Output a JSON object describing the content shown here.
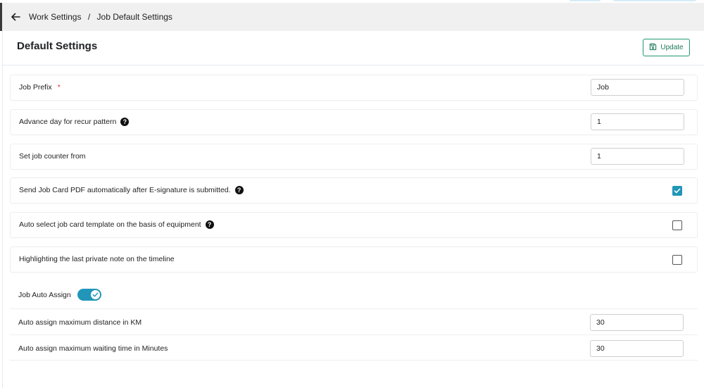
{
  "breadcrumb": {
    "parent": "Work Settings",
    "separator": "/",
    "current": "Job Default Settings"
  },
  "page": {
    "title": "Default Settings",
    "update_label": "Update"
  },
  "settings": {
    "job_prefix": {
      "label": "Job Prefix",
      "required_mark": "*",
      "value": "Job"
    },
    "advance_day": {
      "label": "Advance day for recur pattern",
      "help": "?",
      "value": "1"
    },
    "job_counter": {
      "label": "Set job counter from",
      "value": "1"
    },
    "send_pdf": {
      "label": "Send Job Card PDF automatically after E-signature is submitted.",
      "help": "?",
      "checked": true
    },
    "auto_template": {
      "label": "Auto select job card template on the basis of equipment",
      "help": "?",
      "checked": false
    },
    "highlight_note": {
      "label": "Highlighting the last private note on the timeline",
      "checked": false
    }
  },
  "auto_assign": {
    "label": "Job Auto Assign",
    "enabled": true,
    "max_distance": {
      "label": "Auto assign maximum distance in KM",
      "value": "30"
    },
    "max_wait": {
      "label": "Auto assign maximum waiting time in Minutes",
      "value": "30"
    }
  },
  "colors": {
    "accent": "#2196b8",
    "update_border": "#1e9a71",
    "required": "#e0303a"
  },
  "icons": {
    "back": "arrow-left-icon",
    "update": "save-icon",
    "help": "question-circle-icon",
    "check": "check-icon"
  }
}
